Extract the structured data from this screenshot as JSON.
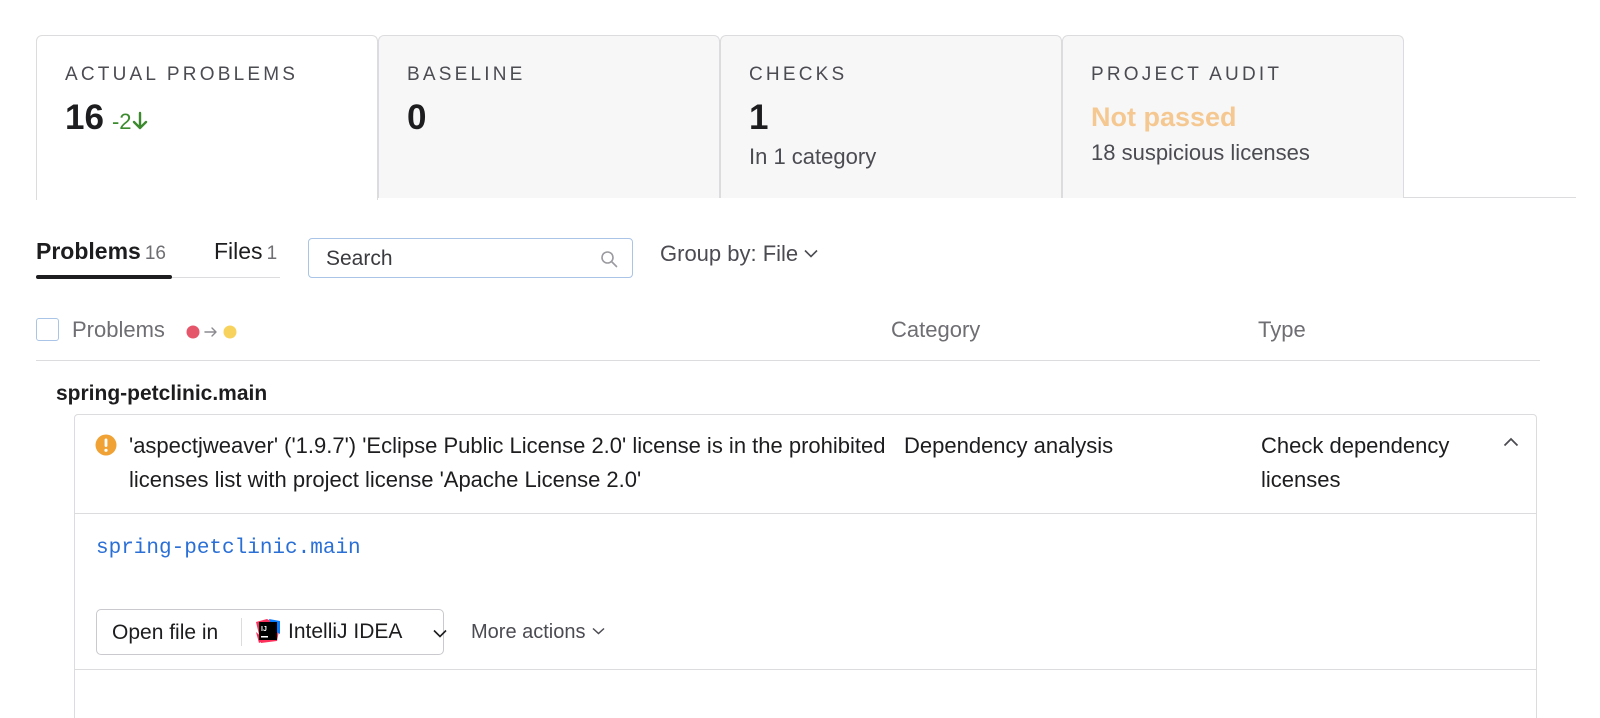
{
  "cards": [
    {
      "label": "ACTUAL PROBLEMS",
      "value": "16",
      "delta": "-2",
      "delta_color": "#3c8a2e",
      "active": true
    },
    {
      "label": "BASELINE",
      "value": "0"
    },
    {
      "label": "CHECKS",
      "value": "1",
      "sub": "In 1 category"
    },
    {
      "label": "PROJECT AUDIT",
      "status": "Not passed",
      "status_color": "#f6c891",
      "sub": "18 suspicious licenses"
    }
  ],
  "tabs": [
    {
      "label": "Problems",
      "count": "16",
      "active": true
    },
    {
      "label": "Files",
      "count": "1",
      "active": false
    }
  ],
  "search": {
    "placeholder": "Search",
    "icon": "search-icon"
  },
  "group_by": {
    "label": "Group by: File"
  },
  "table_header": {
    "problems": "Problems",
    "category": "Category",
    "type": "Type",
    "severity_from_color": "#e5566a",
    "severity_to_color": "#f7d35e"
  },
  "group": {
    "title": "spring-petclinic.main",
    "problem": {
      "severity_icon": "warning-icon",
      "severity_color": "#f0a235",
      "text": "'aspectjweaver' ('1.9.7') 'Eclipse Public License 2.0' license is in the prohibited licenses list with project license 'Apache License 2.0'",
      "category": "Dependency analysis",
      "type": "Check dependency licenses",
      "file_link": "spring-petclinic.main",
      "open_file_label": "Open file in",
      "ide": "IntelliJ IDEA",
      "more_actions": "More actions"
    }
  }
}
